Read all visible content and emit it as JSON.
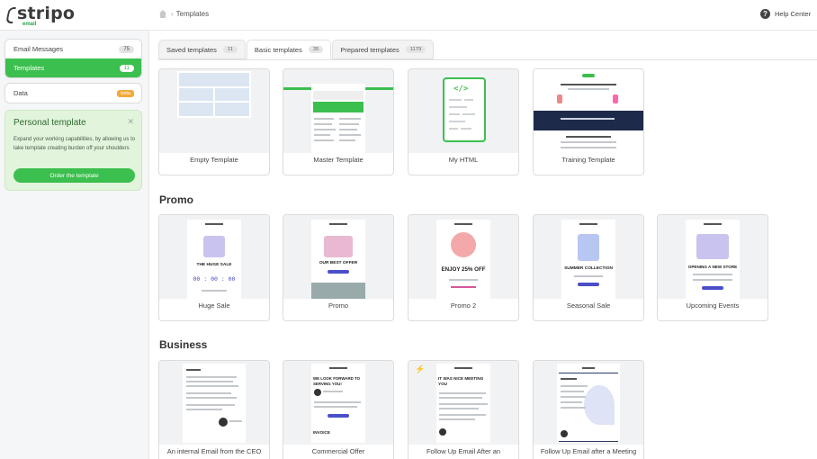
{
  "brand": {
    "name": "stripo",
    "sub": "email"
  },
  "breadcrumb": {
    "current": "Templates"
  },
  "help": {
    "label": "Help Center"
  },
  "sidebar": {
    "items": [
      {
        "label": "Email Messages",
        "count": "75"
      },
      {
        "label": "Templates",
        "count": "11"
      },
      {
        "label": "Data",
        "badge": "beta"
      }
    ],
    "promo": {
      "title": "Personal template",
      "text": "Expand your working capabilities, by allowing us to take template creating burden off your shoulders",
      "button": "Order the template"
    }
  },
  "tabs": [
    {
      "label": "Saved templates",
      "count": "11"
    },
    {
      "label": "Basic templates",
      "count": "35"
    },
    {
      "label": "Prepared templates",
      "count": "1179"
    }
  ],
  "basic": [
    "Empty Template",
    "Master Template",
    "My HTML",
    "Training Template"
  ],
  "sections": {
    "promo": "Promo",
    "business": "Business"
  },
  "promo_cards": [
    "Huge Sale",
    "Promo",
    "Promo 2",
    "Seasonal Sale",
    "Upcoming Events"
  ],
  "business_cards": [
    "An internal Email from the CEO",
    "Commercial Offer",
    "Follow Up Email After an",
    "Follow Up Email after a Meeting"
  ],
  "thumb_text": {
    "huge_sale": "THE HUGE SALE",
    "timer": "00 : 00 : 00",
    "best_offer": "OUR BEST OFFER",
    "enjoy": "ENJOY 25% OFF",
    "summer": "SUMMER COLLECTION",
    "opening": "OPENING A NEW STORE",
    "look_forward": "WE LOOK FORWARD TO SERVING YOU!",
    "invoice": "INVOICE",
    "nice_meeting": "IT WAS NICE MEETING YOU"
  },
  "colors": {
    "accent": "#3bbf4e",
    "beta": "#f2a93b",
    "navy": "#1e2a4a"
  }
}
